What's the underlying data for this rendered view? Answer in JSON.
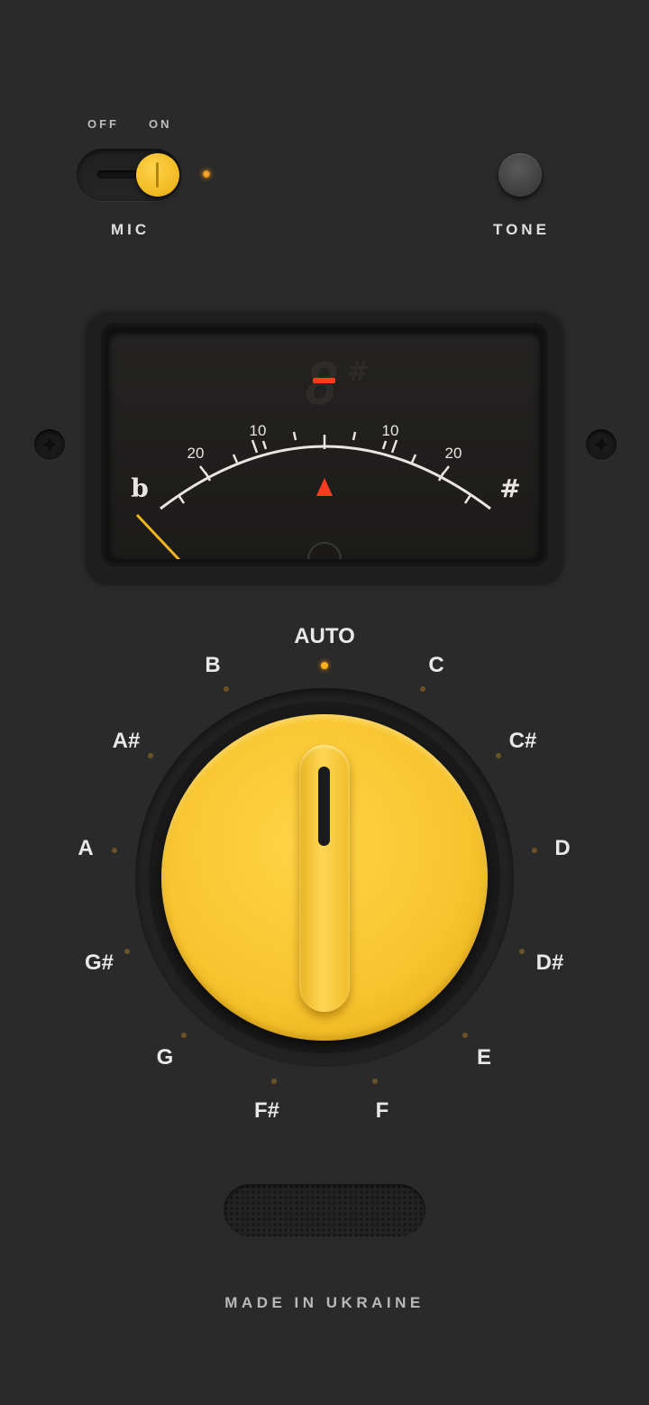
{
  "mic": {
    "off_label": "OFF",
    "on_label": "ON",
    "label": "MIC",
    "state": "on"
  },
  "tone": {
    "label": "TONE"
  },
  "meter": {
    "note_digit": "8",
    "note_accidental": "#",
    "scale_labels": [
      "20",
      "10",
      "10",
      "20"
    ],
    "flat_symbol": "b",
    "sharp_symbol": "#"
  },
  "dial": {
    "auto_label": "AUTO",
    "selected": "AUTO",
    "notes": [
      "C",
      "C#",
      "D",
      "D#",
      "E",
      "F",
      "F#",
      "G",
      "G#",
      "A",
      "A#",
      "B"
    ]
  },
  "footer": {
    "text": "MADE IN UKRAINE"
  },
  "colors": {
    "accent": "#f7c42e",
    "background": "#2a2a2a",
    "led": "#ffb020",
    "needle": "#f0b520",
    "marker": "#ff3b1f"
  }
}
